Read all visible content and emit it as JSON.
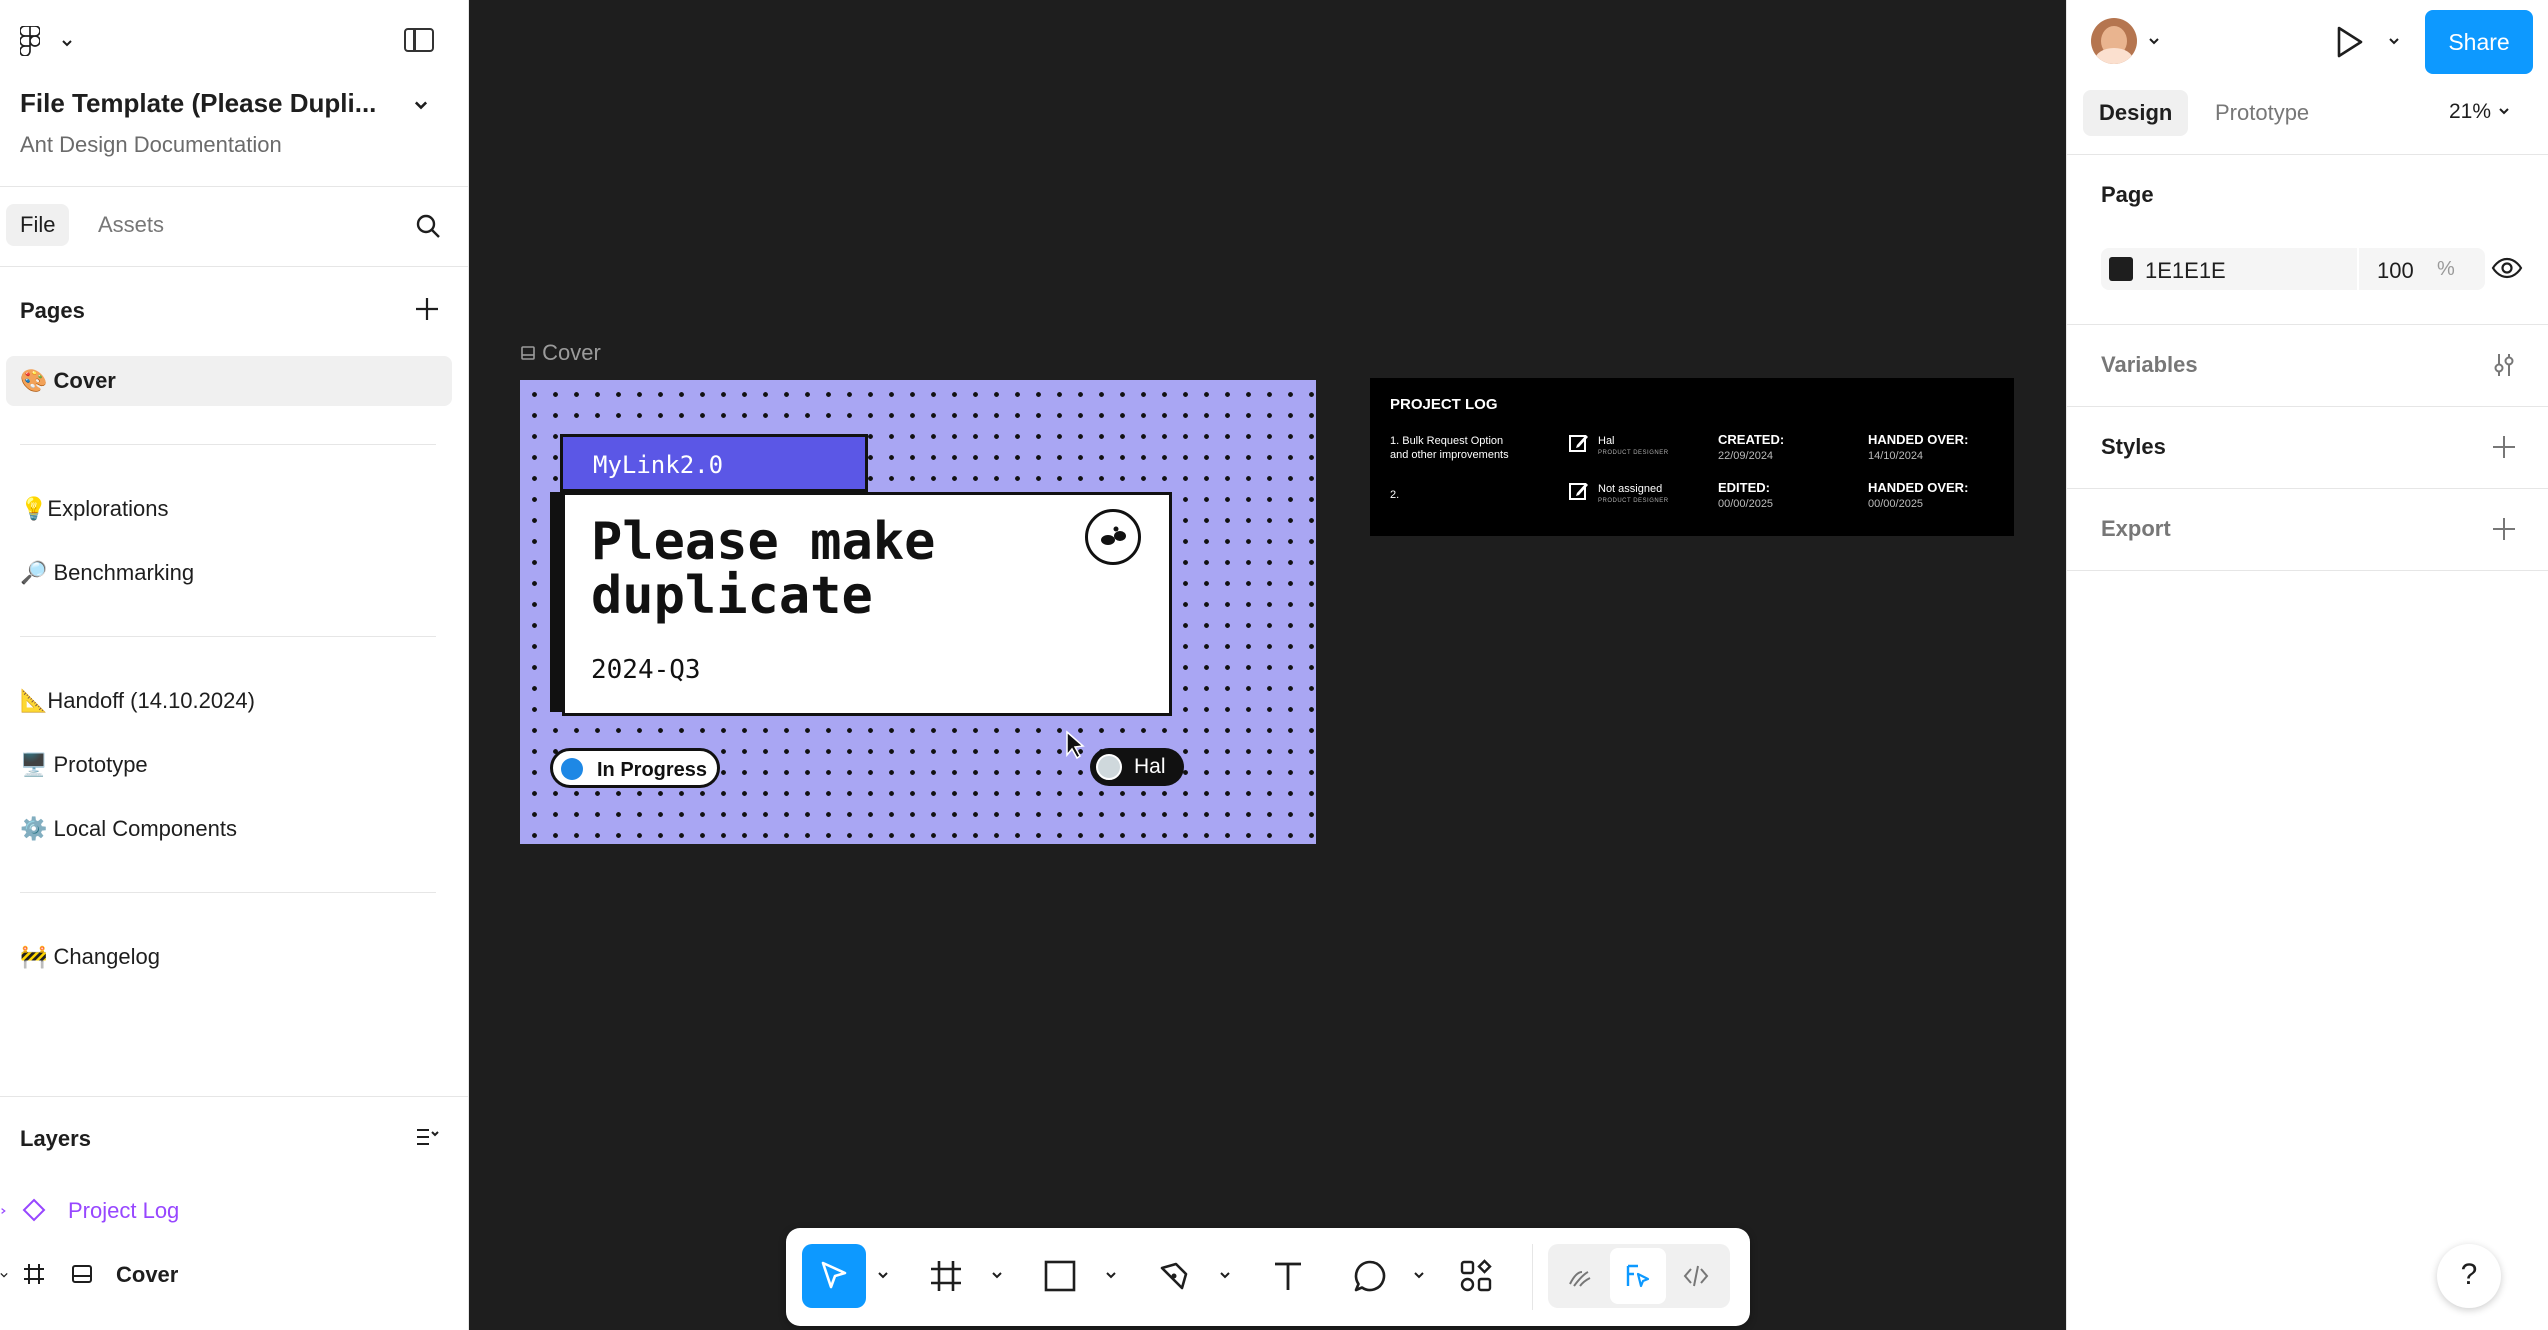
{
  "app": {
    "file_title": "File Template (Please Dupli...",
    "file_subtitle": "Ant Design Documentation"
  },
  "left_tabs": {
    "file": "File",
    "assets": "Assets"
  },
  "pages": {
    "header": "Pages",
    "items": [
      {
        "label": "🎨 Cover",
        "selected": true
      },
      {
        "label": "💡Explorations"
      },
      {
        "label": "🔎 Benchmarking"
      },
      {
        "label": "📐Handoff (14.10.2024)"
      },
      {
        "label": "🖥️ Prototype"
      },
      {
        "label": "⚙️ Local Components"
      },
      {
        "label": "🚧 Changelog"
      }
    ]
  },
  "layers": {
    "header": "Layers",
    "items": [
      {
        "label": "Project Log",
        "color": "#9747ff"
      },
      {
        "label": "Cover"
      }
    ]
  },
  "canvas": {
    "cover_label": "Cover",
    "cover": {
      "tag": "MyLink2.0",
      "title_line1": "Please make",
      "title_line2": "duplicate",
      "date": "2024-Q3",
      "status": "In Progress",
      "assignee": "Hal"
    },
    "project_log": {
      "title": "PROJECT LOG",
      "items": [
        {
          "text1": "1. Bulk Request Option",
          "text2": "and other improvements",
          "person": "Hal",
          "role": "PRODUCT DESIGNER",
          "created_label": "CREATED:",
          "created": "22/09/2024",
          "handed_label": "HANDED OVER:",
          "handed": "14/10/2024"
        },
        {
          "text1": "2.",
          "person": "Not assigned",
          "role": "PRODUCT DESIGNER",
          "edited_label": "EDITED:",
          "edited": "00/00/2025",
          "handed_label": "HANDED OVER:",
          "handed": "00/00/2025"
        }
      ]
    }
  },
  "right_panel": {
    "share": "Share",
    "tabs": {
      "design": "Design",
      "prototype": "Prototype"
    },
    "zoom": "21%",
    "page_section": "Page",
    "page_color": "1E1E1E",
    "page_opacity": "100",
    "percent": "%",
    "variables": "Variables",
    "styles": "Styles",
    "export": "Export",
    "help": "?"
  },
  "colors": {
    "accent": "#0d99ff",
    "cover_bg": "#a9a6f3",
    "cover_tab": "#5b57e6",
    "component": "#9747ff"
  }
}
